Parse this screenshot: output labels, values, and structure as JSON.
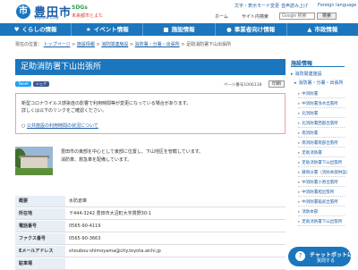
{
  "header": {
    "logo_mark": "市",
    "logo_jp": "豊田市",
    "logo_en": "Toyota City",
    "sdgs_label": "SDGs",
    "sdgs_sub": "未来都市とよた",
    "links": [
      "文字・表示モード変更",
      "音声読み上げ",
      "Foreign language"
    ],
    "utils": [
      "ホーム",
      "サイト内検索",
      "文字サイズ",
      "色合い"
    ],
    "search_placeholder": "Google 検索",
    "search_button": "検索"
  },
  "nav": [
    {
      "icon": "♥",
      "label": "くらしの情報"
    },
    {
      "icon": "★",
      "label": "イベント情報"
    },
    {
      "icon": "■",
      "label": "施設情報"
    },
    {
      "icon": "●",
      "label": "事業者向け情報"
    },
    {
      "icon": "▲",
      "label": "市政情報"
    }
  ],
  "breadcrumb": {
    "prefix": "現在の位置：",
    "items": [
      "トップページ",
      "施設情報",
      "消防関連施設",
      "消防署・分署・出張所"
    ],
    "current": "足助消防署下山出張所"
  },
  "page": {
    "title": "足助消防署下山出張所",
    "page_id": "ページ番号1006138",
    "print": "印刷",
    "sns": [
      "Tweet",
      "シェア"
    ]
  },
  "notice": {
    "line1": "新型コロナウイルス感染症の影響で利用時間等が変更になっている場合があります。",
    "line2": "詳しくは以下のリンクをご確認ください。",
    "link": "公共施設の利用時間の状況について"
  },
  "description": {
    "line1": "豊田市の東部を中心として東部に位置し、下山地区を管轄しています。",
    "line2": "消防車、救急車を配備しています。"
  },
  "info_table": [
    {
      "label": "概要",
      "value": "水防倉庫"
    },
    {
      "label": "所在地",
      "value": "〒444-3242 豊田市大沼町大字貫野30-1"
    },
    {
      "label": "電話番号",
      "value": "0565-90-4119"
    },
    {
      "label": "ファクス番号",
      "value": "0565-90-3663"
    },
    {
      "label": "Eメールアドレス",
      "value": "shoubou-shimoyama@city.toyota.aichi.jp"
    },
    {
      "label": "駐車場",
      "value": ""
    }
  ],
  "sidebar": {
    "title": "施設情報",
    "section": "消防関連施設",
    "subsection": "消防署・分署・出張所",
    "items": [
      "中消防署",
      "中消防署浄水出張所",
      "北消防署",
      "北消防署西部出張所",
      "南消防署",
      "南消防署南部出張所",
      "足助消防署",
      "足助消防署下山出張所",
      "藤岡分署（消防本部併設）",
      "中消防署小原出張所",
      "中消防署旭出張所",
      "中消防署稲武出張所",
      "消防本部",
      "足助消防署下山出張所"
    ]
  },
  "chat": {
    "line1": "チャットボットに",
    "line2": "質問する"
  },
  "colors": {
    "brand": "#1b76bd",
    "notice_border": "#e6a2a2"
  }
}
